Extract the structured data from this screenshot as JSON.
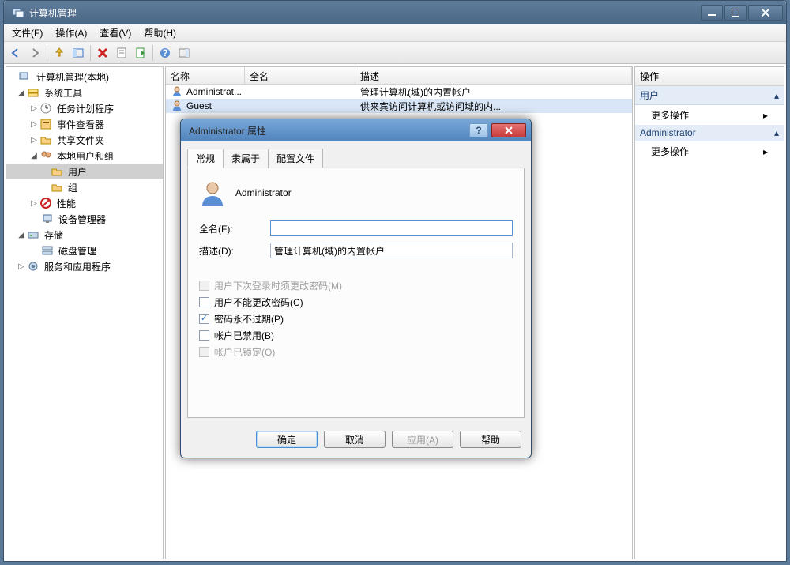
{
  "window": {
    "title": "计算机管理"
  },
  "menu": {
    "file": "文件(F)",
    "action": "操作(A)",
    "view": "查看(V)",
    "help": "帮助(H)"
  },
  "tree": {
    "root": "计算机管理(本地)",
    "systools": "系统工具",
    "taskSched": "任务计划程序",
    "eventViewer": "事件查看器",
    "sharedFolders": "共享文件夹",
    "localUsersGroups": "本地用户和组",
    "users": "用户",
    "groups": "组",
    "perf": "性能",
    "devmgr": "设备管理器",
    "storage": "存储",
    "diskmgmt": "磁盘管理",
    "services": "服务和应用程序"
  },
  "list": {
    "cols": {
      "name": "名称",
      "fullname": "全名",
      "desc": "描述"
    },
    "rows": [
      {
        "name": "Administrat...",
        "fullname": "",
        "desc": "管理计算机(域)的内置帐户"
      },
      {
        "name": "Guest",
        "fullname": "",
        "desc": "供来宾访问计算机或访问域的内..."
      }
    ]
  },
  "actions": {
    "header": "操作",
    "sec1": "用户",
    "more": "更多操作",
    "sec2": "Administrator"
  },
  "dialog": {
    "title": "Administrator 属性",
    "tabs": {
      "general": "常规",
      "memberof": "隶属于",
      "profile": "配置文件"
    },
    "username": "Administrator",
    "labels": {
      "fullname": "全名(F):",
      "desc": "描述(D):"
    },
    "fields": {
      "fullname": "",
      "desc": "管理计算机(域)的内置帐户"
    },
    "checks": {
      "mustChange": "用户下次登录时须更改密码(M)",
      "cannotChange": "用户不能更改密码(C)",
      "neverExpire": "密码永不过期(P)",
      "disabled": "帐户已禁用(B)",
      "locked": "帐户已锁定(O)"
    },
    "buttons": {
      "ok": "确定",
      "cancel": "取消",
      "apply": "应用(A)",
      "help": "帮助"
    }
  }
}
